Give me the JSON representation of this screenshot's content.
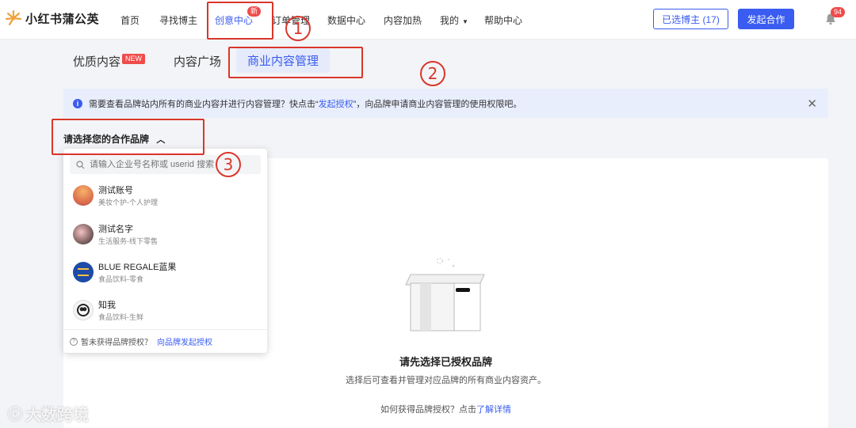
{
  "header": {
    "logo_text": "小红书蒲公英",
    "nav": [
      "首页",
      "寻找博主",
      "创意中心",
      "订单管理",
      "数据中心",
      "内容加热",
      "我的",
      "帮助中心"
    ],
    "new_badge": "新",
    "selected_bloggers": "已选博主 (17)",
    "start_collab": "发起合作",
    "notification_count": "94"
  },
  "subtabs": {
    "quality": "优质内容",
    "new_pill": "NEW",
    "square": "内容广场",
    "biz": "商业内容管理"
  },
  "banner": {
    "text_a": "需要查看品牌站内所有的商业内容并进行内容管理？快点击“",
    "link": "发起授权",
    "text_b": "”，向品牌申请商业内容管理的使用权限吧。"
  },
  "brand_select": {
    "label": "请选择您的合作品牌",
    "search_placeholder": "请输入企业号名称或 userid 搜索",
    "items": [
      {
        "name": "测试账号",
        "category": "美妆个护-个人护理"
      },
      {
        "name": "测试名字",
        "category": "生活服务-线下零售"
      },
      {
        "name": "BLUE REGALE蓝果",
        "category": "食品饮料-零食"
      },
      {
        "name": "知我",
        "category": "食品饮料-生鲜"
      }
    ],
    "footer_text": "暂未获得品牌授权？",
    "footer_link": "向品牌发起授权"
  },
  "empty": {
    "title": "请先选择已授权品牌",
    "desc": "选择后可查看并管理对应品牌的所有商业内容资产。",
    "help_text": "如何获得品牌授权？点击",
    "help_link": "了解详情"
  },
  "annotations": [
    "1",
    "2",
    "3"
  ],
  "watermark": "大数跨境",
  "colors": {
    "accent": "#3a5cf0",
    "annotation": "#d9362b",
    "badge": "#f04a4a"
  }
}
